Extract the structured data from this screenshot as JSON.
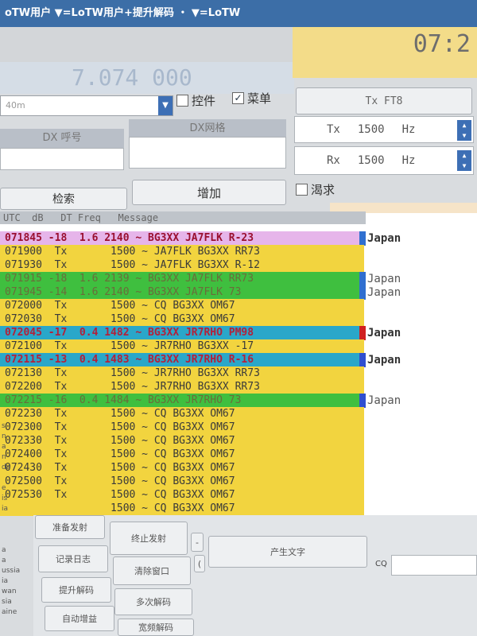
{
  "window": {
    "title": "oTW用户 ▼=LoTW用户+提升解码 ・ ▼=LoTW"
  },
  "display": {
    "frequency": "7.074 000",
    "clock": "07:2"
  },
  "controls": {
    "band": "40m",
    "ctrl_label": "控件",
    "menu_label": "菜单",
    "dx_call_label": "DX 呼号",
    "dx_grid_label": "DX网格",
    "search_label": "检索",
    "add_label": "增加",
    "tx_mode": "Tx FT8",
    "tx_label": "Tx",
    "tx_hz": "1500",
    "rx_label": "Rx",
    "rx_hz": "1500",
    "hz_unit": "Hz",
    "want_label": "渴求"
  },
  "list": {
    "header": "UTC  dB   DT Freq   Message",
    "rows": [
      {
        "text": "071845 -18  1.6 2140 ~ BG3XX JA7FLK R-23",
        "bg": "#e6b5ea",
        "fg": "#9a1030",
        "bold": true,
        "country": "Japan",
        "marker": "#2f6fd0"
      },
      {
        "text": "071900  Tx       1500 ~ JA7FLK BG3XX RR73",
        "bg": "#f2d43f",
        "fg": "#3a3a3a",
        "bold": false,
        "country": "",
        "marker": ""
      },
      {
        "text": "071930  Tx       1500 ~ JA7FLK BG3XX R-12",
        "bg": "#f2d43f",
        "fg": "#3a3a3a",
        "bold": false,
        "country": "",
        "marker": ""
      },
      {
        "text": "071915 -18  1.6 2139 ~ BG3XX JA7FLK RR73",
        "bg": "#3fbf3f",
        "fg": "#6b6b3a",
        "bold": false,
        "country": "Japan",
        "marker": "#2f6fd0"
      },
      {
        "text": "071945 -14  1.6 2140 ~ BG3XX JA7FLK 73",
        "bg": "#3fbf3f",
        "fg": "#6b6b3a",
        "bold": false,
        "country": "Japan",
        "marker": "#2f6fd0"
      },
      {
        "text": "072000  Tx       1500 ~ CQ BG3XX OM67",
        "bg": "#f2d43f",
        "fg": "#3a3a3a",
        "bold": false,
        "country": "",
        "marker": ""
      },
      {
        "text": "072030  Tx       1500 ~ CQ BG3XX OM67",
        "bg": "#f2d43f",
        "fg": "#3a3a3a",
        "bold": false,
        "country": "",
        "marker": ""
      },
      {
        "text": "072045 -17  0.4 1482 ~ BG3XX JR7RHO PM98",
        "bg": "#2aa7c9",
        "fg": "#b3203a",
        "bold": true,
        "country": "Japan",
        "marker": "#d02020"
      },
      {
        "text": "072100  Tx       1500 ~ JR7RHO BG3XX -17",
        "bg": "#f2d43f",
        "fg": "#3a3a3a",
        "bold": false,
        "country": "",
        "marker": ""
      },
      {
        "text": "072115 -13  0.4 1483 ~ BG3XX JR7RHO R-16",
        "bg": "#2aa7c9",
        "fg": "#b3203a",
        "bold": true,
        "country": "Japan",
        "marker": "#2f4fd0"
      },
      {
        "text": "072130  Tx       1500 ~ JR7RHO BG3XX RR73",
        "bg": "#f2d43f",
        "fg": "#3a3a3a",
        "bold": false,
        "country": "",
        "marker": ""
      },
      {
        "text": "072200  Tx       1500 ~ JR7RHO BG3XX RR73",
        "bg": "#f2d43f",
        "fg": "#3a3a3a",
        "bold": false,
        "country": "",
        "marker": ""
      },
      {
        "text": "072215 -16  0.4 1484 ~ BG3XX JR7RHO 73",
        "bg": "#3fbf3f",
        "fg": "#6b6b3a",
        "bold": false,
        "country": "Japan",
        "marker": "#2f4fd0"
      },
      {
        "text": "072230  Tx       1500 ~ CQ BG3XX OM67",
        "bg": "#f2d43f",
        "fg": "#3a3a3a",
        "bold": false,
        "country": "",
        "marker": ""
      },
      {
        "text": "072300  Tx       1500 ~ CQ BG3XX OM67",
        "bg": "#f2d43f",
        "fg": "#3a3a3a",
        "bold": false,
        "country": "",
        "marker": ""
      },
      {
        "text": "072330  Tx       1500 ~ CQ BG3XX OM67",
        "bg": "#f2d43f",
        "fg": "#3a3a3a",
        "bold": false,
        "country": "",
        "marker": ""
      },
      {
        "text": "072400  Tx       1500 ~ CQ BG3XX OM67",
        "bg": "#f2d43f",
        "fg": "#3a3a3a",
        "bold": false,
        "country": "",
        "marker": ""
      },
      {
        "text": "072430  Tx       1500 ~ CQ BG3XX OM67",
        "bg": "#f2d43f",
        "fg": "#3a3a3a",
        "bold": false,
        "country": "",
        "marker": ""
      },
      {
        "text": "072500  Tx       1500 ~ CQ BG3XX OM67",
        "bg": "#f2d43f",
        "fg": "#3a3a3a",
        "bold": false,
        "country": "",
        "marker": ""
      },
      {
        "text": "072530  Tx       1500 ~ CQ BG3XX OM67",
        "bg": "#f2d43f",
        "fg": "#3a3a3a",
        "bold": false,
        "country": "",
        "marker": ""
      },
      {
        "text": "                 1500 ~ CQ BG3XX OM67",
        "bg": "#f2d43f",
        "fg": "#3a3a3a",
        "bold": false,
        "country": "",
        "marker": ""
      }
    ]
  },
  "buttons": {
    "prepare_tx": "准备发射",
    "stop_tx": "终止发射",
    "gen_text": "产生文字",
    "cq": "CQ",
    "log": "记录日志",
    "clear_window": "清除窗口",
    "boost_decode": "提升解码",
    "multi_decode": "多次解码",
    "auto_reply": "自动增益",
    "freq_decode": "宽频解码",
    "minus": "-",
    "bracket": "("
  },
  "leftcol": "s\nn\na\nn\nda\n\ne\nis\nia\n\n\n\na\na\nussia\nia\nwan\nsia\naine"
}
